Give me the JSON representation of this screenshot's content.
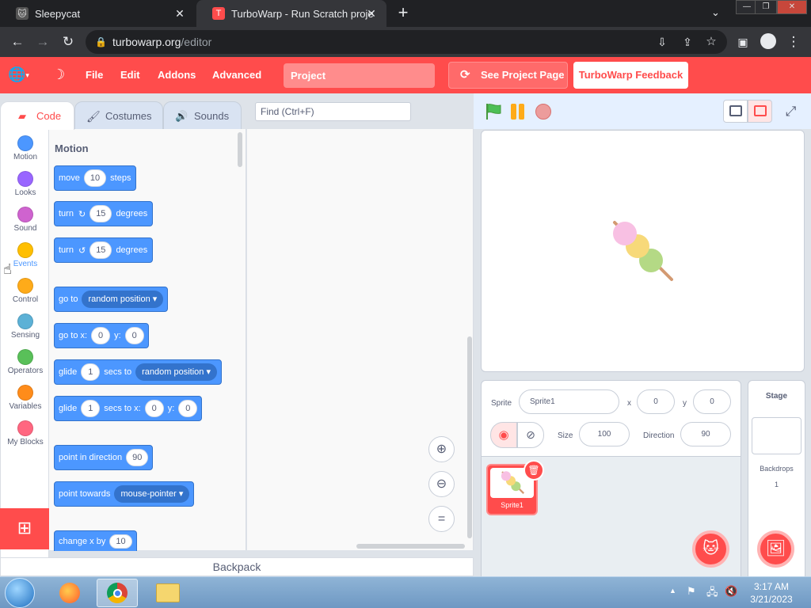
{
  "browser": {
    "tabs": [
      {
        "title": "Sleepycat"
      },
      {
        "title": "TurboWarp - Run Scratch project"
      }
    ],
    "url_domain": "turbowarp.org",
    "url_path": "/editor"
  },
  "menubar": {
    "items": [
      "File",
      "Edit",
      "Addons",
      "Advanced"
    ],
    "project_title": "Project",
    "see_project": "See Project Page",
    "feedback": "TurboWarp Feedback"
  },
  "editor_tabs": [
    "Code",
    "Costumes",
    "Sounds"
  ],
  "find_placeholder": "Find (Ctrl+F)",
  "categories": [
    {
      "label": "Motion",
      "color": "#4c97ff"
    },
    {
      "label": "Looks",
      "color": "#9966ff"
    },
    {
      "label": "Sound",
      "color": "#cf63cf"
    },
    {
      "label": "Events",
      "color": "#ffbf00"
    },
    {
      "label": "Control",
      "color": "#ffab19"
    },
    {
      "label": "Sensing",
      "color": "#5cb1d6"
    },
    {
      "label": "Operators",
      "color": "#59c059"
    },
    {
      "label": "Variables",
      "color": "#ff8c1a"
    },
    {
      "label": "My Blocks",
      "color": "#ff6680"
    }
  ],
  "palette": {
    "heading": "Motion",
    "blocks": {
      "move": {
        "a": "move",
        "v1": "10",
        "b": "steps"
      },
      "turn_cw": {
        "a": "turn",
        "v1": "15",
        "b": "degrees"
      },
      "turn_ccw": {
        "a": "turn",
        "v1": "15",
        "b": "degrees"
      },
      "goto": {
        "a": "go to",
        "d1": "random position"
      },
      "gotoxy": {
        "a": "go to x:",
        "v1": "0",
        "b": "y:",
        "v2": "0"
      },
      "glide": {
        "a": "glide",
        "v1": "1",
        "b": "secs to",
        "d1": "random position"
      },
      "glidexy": {
        "a": "glide",
        "v1": "1",
        "b": "secs to x:",
        "v2": "0",
        "c": "y:",
        "v3": "0"
      },
      "direction": {
        "a": "point in direction",
        "v1": "90"
      },
      "towards": {
        "a": "point towards",
        "d1": "mouse-pointer"
      },
      "changex": {
        "a": "change x by",
        "v1": "10"
      }
    }
  },
  "backpack": "Backpack",
  "sprite_info": {
    "sprite_label": "Sprite",
    "sprite_name": "Sprite1",
    "x_label": "x",
    "x": "0",
    "y_label": "y",
    "y": "0",
    "show_label": "Show",
    "size_label": "Size",
    "size": "100",
    "direction_label": "Direction",
    "direction": "90"
  },
  "sprites": [
    {
      "name": "Sprite1"
    }
  ],
  "stage_panel": {
    "title": "Stage",
    "backdrops_label": "Backdrops",
    "backdrops_count": "1"
  },
  "taskbar": {
    "time": "3:17 AM",
    "date": "3/21/2023"
  },
  "colors": {
    "accent": "#ff4c4c",
    "motion": "#4c97ff"
  }
}
